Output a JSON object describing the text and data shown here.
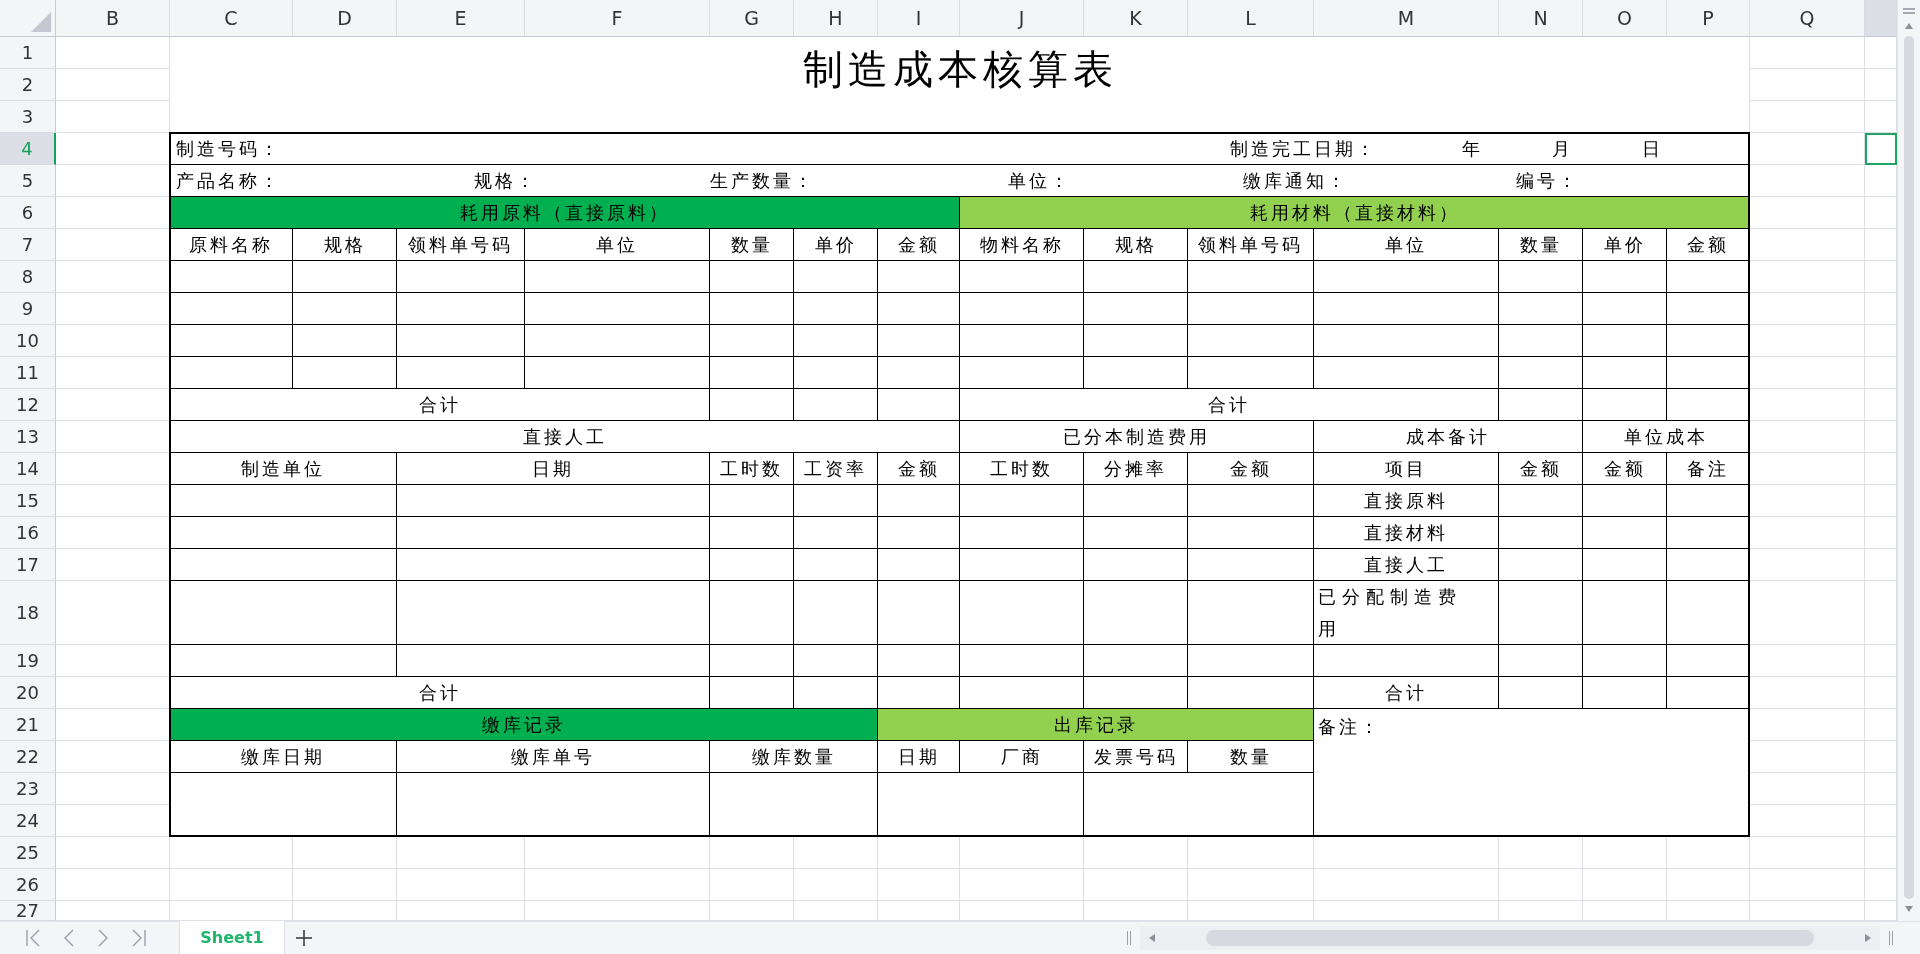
{
  "column_headers": [
    {
      "label": "B",
      "selected": false
    },
    {
      "label": "C",
      "selected": false
    },
    {
      "label": "D",
      "selected": false
    },
    {
      "label": "E",
      "selected": false
    },
    {
      "label": "F",
      "selected": false
    },
    {
      "label": "G",
      "selected": false
    },
    {
      "label": "H",
      "selected": false
    },
    {
      "label": "I",
      "selected": false
    },
    {
      "label": "J",
      "selected": false
    },
    {
      "label": "K",
      "selected": false
    },
    {
      "label": "L",
      "selected": false
    },
    {
      "label": "M",
      "selected": false
    },
    {
      "label": "N",
      "selected": false
    },
    {
      "label": "O",
      "selected": false
    },
    {
      "label": "P",
      "selected": false
    },
    {
      "label": "Q",
      "selected": false
    },
    {
      "selected": true
    }
  ],
  "row_headers": [
    {
      "label": "1",
      "selected": false
    },
    {
      "label": "2",
      "selected": false
    },
    {
      "label": "3",
      "selected": false
    },
    {
      "label": "4",
      "selected": true
    },
    {
      "label": "5",
      "selected": false
    },
    {
      "label": "6",
      "selected": false
    },
    {
      "label": "7",
      "selected": false
    },
    {
      "label": "8",
      "selected": false
    },
    {
      "label": "9",
      "selected": false
    },
    {
      "label": "10",
      "selected": false
    },
    {
      "label": "11",
      "selected": false
    },
    {
      "label": "12",
      "selected": false
    },
    {
      "label": "13",
      "selected": false
    },
    {
      "label": "14",
      "selected": false
    },
    {
      "label": "15",
      "selected": false
    },
    {
      "label": "16",
      "selected": false
    },
    {
      "label": "17",
      "selected": false
    },
    {
      "label": "18",
      "selected": false
    },
    {
      "label": "19",
      "selected": false
    },
    {
      "label": "20",
      "selected": false
    },
    {
      "label": "21",
      "selected": false
    },
    {
      "label": "22",
      "selected": false
    },
    {
      "label": "23",
      "selected": false
    },
    {
      "label": "24",
      "selected": false
    },
    {
      "label": "25",
      "selected": false
    },
    {
      "label": "26",
      "selected": false
    },
    {
      "label": "27",
      "selected": false
    }
  ],
  "cells": [
    {
      "kind": "title",
      "text": "制造成本核算表"
    },
    {
      "kind": "field_label",
      "text": "制造号码："
    },
    {
      "kind": "field_label",
      "text": "制造完工日期："
    },
    {
      "kind": "field_label",
      "text": "年"
    },
    {
      "kind": "field_label",
      "text": "月"
    },
    {
      "kind": "field_label",
      "text": "日"
    },
    {
      "kind": "field_label",
      "text": "产品名称："
    },
    {
      "kind": "field_label",
      "text": "规格："
    },
    {
      "kind": "field_label",
      "text": "生产数量："
    },
    {
      "kind": "field_label",
      "text": "单位："
    },
    {
      "kind": "field_label",
      "text": "缴库通知："
    },
    {
      "kind": "field_label",
      "text": "编号："
    },
    {
      "kind": "section",
      "text": "耗用原料（直接原料）",
      "color": "#00b050"
    },
    {
      "kind": "section",
      "text": "耗用材料（直接材料）",
      "color": "#92d050"
    },
    {
      "kind": "column_header",
      "text": "原料名称"
    },
    {
      "kind": "column_header",
      "text": "规格"
    },
    {
      "kind": "column_header",
      "text": "领料单号码"
    },
    {
      "kind": "column_header",
      "text": "单位"
    },
    {
      "kind": "column_header",
      "text": "数量"
    },
    {
      "kind": "column_header",
      "text": "单价"
    },
    {
      "kind": "column_header",
      "text": "金额"
    },
    {
      "kind": "column_header",
      "text": "物料名称"
    },
    {
      "kind": "column_header",
      "text": "规格"
    },
    {
      "kind": "column_header",
      "text": "领料单号码"
    },
    {
      "kind": "column_header",
      "text": "单位"
    },
    {
      "kind": "column_header",
      "text": "数量"
    },
    {
      "kind": "column_header",
      "text": "单价"
    },
    {
      "kind": "column_header",
      "text": "金额"
    },
    {
      "kind": "total_label",
      "text": "合计"
    },
    {
      "kind": "total_label",
      "text": "合计"
    },
    {
      "kind": "column_header",
      "text": "直接人工"
    },
    {
      "kind": "column_header",
      "text": "已分本制造费用"
    },
    {
      "kind": "column_header",
      "text": "成本备计"
    },
    {
      "kind": "column_header",
      "text": "单位成本"
    },
    {
      "kind": "column_header",
      "text": "制造单位"
    },
    {
      "kind": "column_header",
      "text": "日期"
    },
    {
      "kind": "column_header",
      "text": "工时数"
    },
    {
      "kind": "column_header",
      "text": "工资率"
    },
    {
      "kind": "column_header",
      "text": "金额"
    },
    {
      "kind": "column_header",
      "text": "工时数"
    },
    {
      "kind": "column_header",
      "text": "分摊率"
    },
    {
      "kind": "column_header",
      "text": "金额"
    },
    {
      "kind": "column_header",
      "text": "项目"
    },
    {
      "kind": "column_header",
      "text": "金额"
    },
    {
      "kind": "column_header",
      "text": "金额"
    },
    {
      "kind": "column_header",
      "text": "备注"
    },
    {
      "kind": "row_label",
      "text": "直接原料"
    },
    {
      "kind": "row_label",
      "text": "直接材料"
    },
    {
      "kind": "row_label",
      "text": "直接人工"
    },
    {
      "kind": "row_label",
      "text": "已分配制造费用"
    },
    {
      "kind": "total_label",
      "text": "合计"
    },
    {
      "kind": "total_label",
      "text": "合计"
    },
    {
      "kind": "section",
      "text": "缴库记录",
      "color": "#00b050"
    },
    {
      "kind": "section",
      "text": "出库记录",
      "color": "#92d050"
    },
    {
      "kind": "field_label",
      "text": "备注："
    },
    {
      "kind": "column_header",
      "text": "缴库日期"
    },
    {
      "kind": "column_header",
      "text": "缴库单号"
    },
    {
      "kind": "column_header",
      "text": "缴库数量"
    },
    {
      "kind": "column_header",
      "text": "日期"
    },
    {
      "kind": "column_header",
      "text": "厂商"
    },
    {
      "kind": "column_header",
      "text": "发票号码"
    },
    {
      "kind": "column_header",
      "text": "数量"
    }
  ],
  "sheet_tabs": [
    {
      "label": "Sheet1",
      "selected": true
    }
  ]
}
